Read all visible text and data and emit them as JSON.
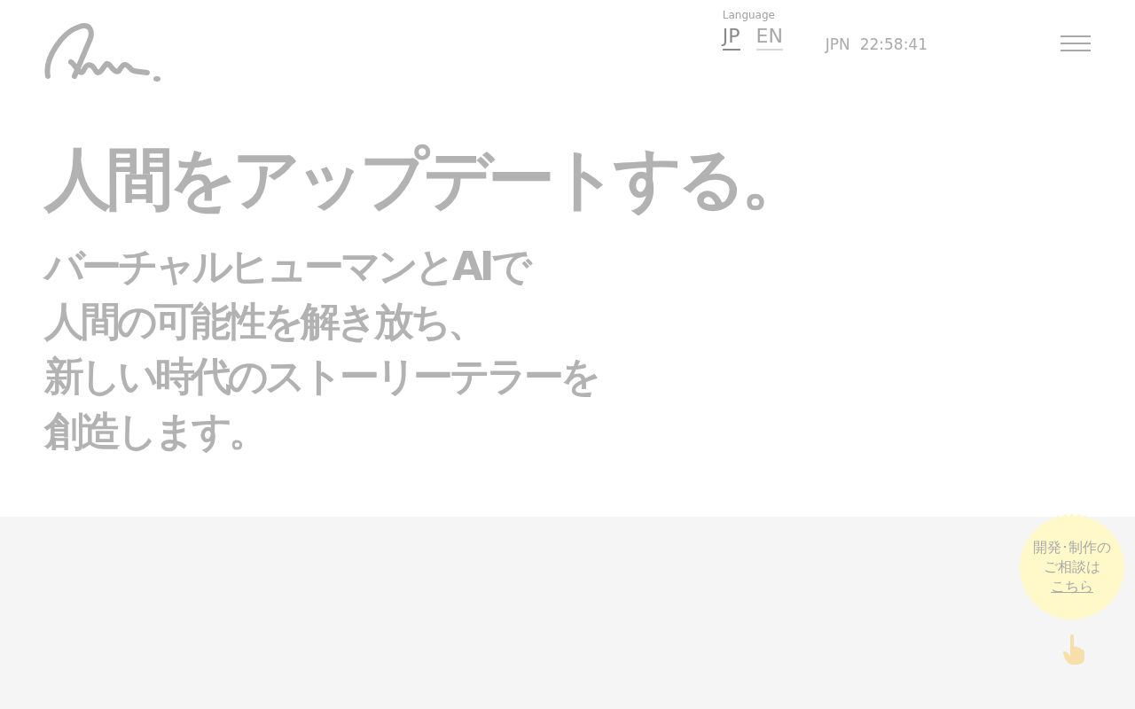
{
  "header": {
    "language_label": "Language",
    "languages": [
      {
        "label": "JP",
        "selected": true
      },
      {
        "label": "EN",
        "selected": false
      }
    ],
    "clock": {
      "zone": "JPN",
      "time": "22:58:41"
    }
  },
  "hero": {
    "title": "人間をアップデートする。",
    "lines": [
      "バーチャルヒューマンとAIで",
      "人間の可能性を解き放ち、",
      "新しい時代のストーリーテラーを",
      "創造します。"
    ]
  },
  "consult_badge": {
    "lines": [
      "開発･制作の",
      "ご相談は"
    ],
    "link": "こちら"
  }
}
